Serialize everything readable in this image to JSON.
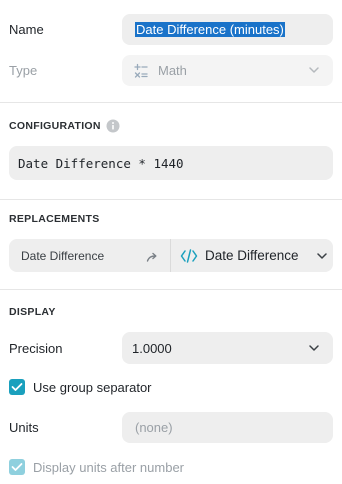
{
  "general": {
    "name_label": "Name",
    "name_value": "Date Difference (minutes)",
    "type_label": "Type",
    "type_value": "Math",
    "type_icon": "math-operators-icon"
  },
  "configuration": {
    "title": "CONFIGURATION",
    "info_icon": "info-icon",
    "formula": "Date Difference * 1440"
  },
  "replacements": {
    "title": "REPLACEMENTS",
    "source": "Date Difference",
    "arrow_icon": "arrow-icon",
    "target_icon": "code-icon",
    "target": "Date Difference"
  },
  "display": {
    "title": "DISPLAY",
    "precision_label": "Precision",
    "precision_value": "1.0000",
    "group_separator_label": "Use group separator",
    "group_separator_checked": true,
    "units_label": "Units",
    "units_placeholder": "(none)",
    "units_after_label": "Display units after number",
    "units_after_checked": true
  },
  "colors": {
    "accent": "#1aa0bd",
    "selection": "#1a73c9",
    "field_bg": "#eeeeee"
  }
}
